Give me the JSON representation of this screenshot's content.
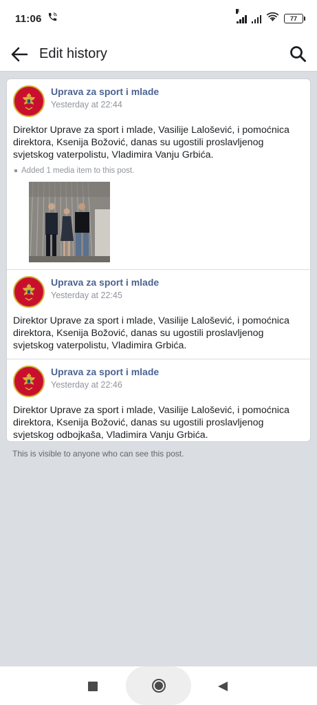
{
  "status_bar": {
    "time": "11:06",
    "battery": "77",
    "signal_label": "R",
    "icons": [
      "call-icon",
      "signal-icon",
      "wifi-icon",
      "battery-icon"
    ]
  },
  "header": {
    "title": "Edit history",
    "back_icon": "arrow-left-icon",
    "search_icon": "search-icon"
  },
  "entries": [
    {
      "author": "Uprava za sport i mlade",
      "time": "Yesterday at 22:44",
      "text": "Direktor Uprave za sport i mlade, Vasilije Lalošević, i pomoćnica direktora, Ksenija Božović, danas su ugostili proslavljenog svjetskog vaterpolistu, Vladimira Vanju Grbića.",
      "change": "Added 1 media item to this post."
    },
    {
      "author": "Uprava za sport i mlade",
      "time": "Yesterday at 22:45",
      "text": "Direktor Uprave za sport i mlade, Vasilije Lalošević, i pomoćnica direktora, Ksenija Božović, danas su ugostili proslavljenog svjetskog vaterpolistu, Vladimira Grbića."
    },
    {
      "author": "Uprava za sport i mlade",
      "time": "Yesterday at 22:46",
      "text": "Direktor Uprave za sport i mlade, Vasilije Lalošević, i pomoćnica direktora, Ksenija Božović, danas su ugostili proslavljenog svjetskog odbojkaša, Vladimira Vanju Grbića."
    }
  ],
  "footer_note": "This is visible to anyone who can see this post.",
  "nav": {
    "recents_icon": "square-icon",
    "home_icon": "circle-icon",
    "back_icon": "triangle-back-icon"
  },
  "colors": {
    "page_bg": "#dadde1",
    "link": "#4b6392",
    "meta_text": "#90949c",
    "avatar_red": "#c8102e",
    "avatar_gold": "#d4af37"
  }
}
